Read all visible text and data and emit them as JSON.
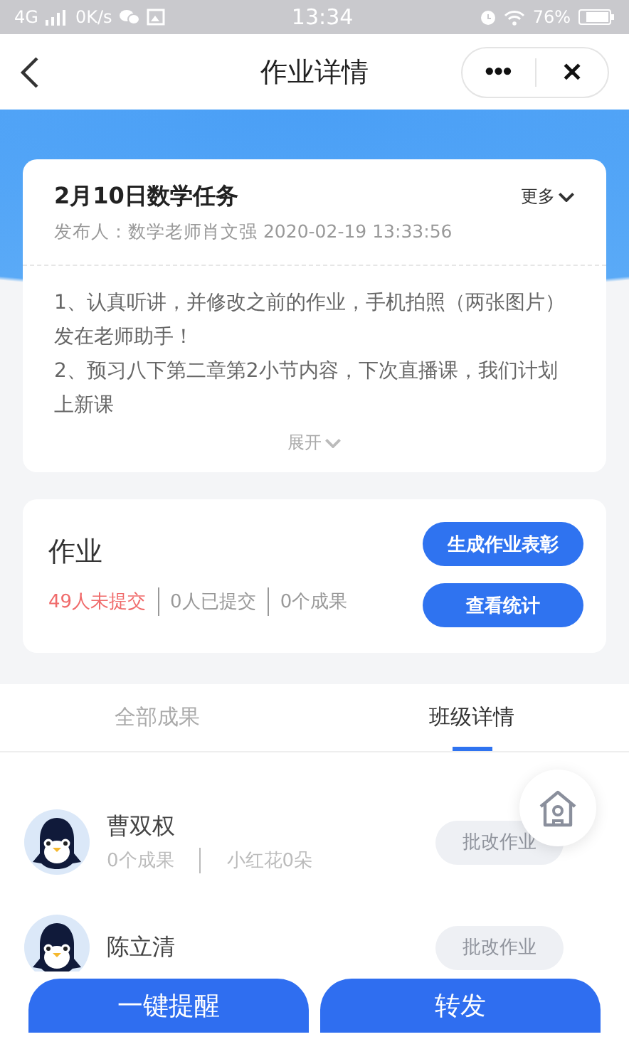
{
  "status_bar": {
    "network": "4G",
    "speed": "0K/s",
    "time": "13:34",
    "battery": "76%"
  },
  "nav": {
    "title": "作业详情",
    "more": "•••",
    "close": "✕"
  },
  "task": {
    "title": "2月10日数学任务",
    "more": "更多",
    "meta": "发布人：数学老师肖文强 2020-02-19 13:33:56",
    "lines": [
      "1、认真听讲，并修改之前的作业，手机拍照（两张图片）发在老师助手！",
      "2、预习八下第二章第2小节内容，下次直播课，我们计划上新课"
    ],
    "expand": "展开"
  },
  "homework": {
    "title": "作业",
    "stats": [
      {
        "text": "49人未提交",
        "kind": "alert"
      },
      {
        "text": "0人已提交",
        "kind": "normal"
      },
      {
        "text": "0个成果",
        "kind": "normal"
      }
    ],
    "buttons": [
      "生成作业表彰",
      "查看统计"
    ]
  },
  "tabs": [
    {
      "label": "全部成果",
      "selected": false
    },
    {
      "label": "班级详情",
      "selected": true
    }
  ],
  "students": [
    {
      "name": "曹双权",
      "results": "0个成果",
      "flowers": "小红花0朵",
      "action": "批改作业"
    },
    {
      "name": "陈立清",
      "action": "批改作业"
    }
  ],
  "footer": [
    "一键提醒",
    "转发"
  ]
}
